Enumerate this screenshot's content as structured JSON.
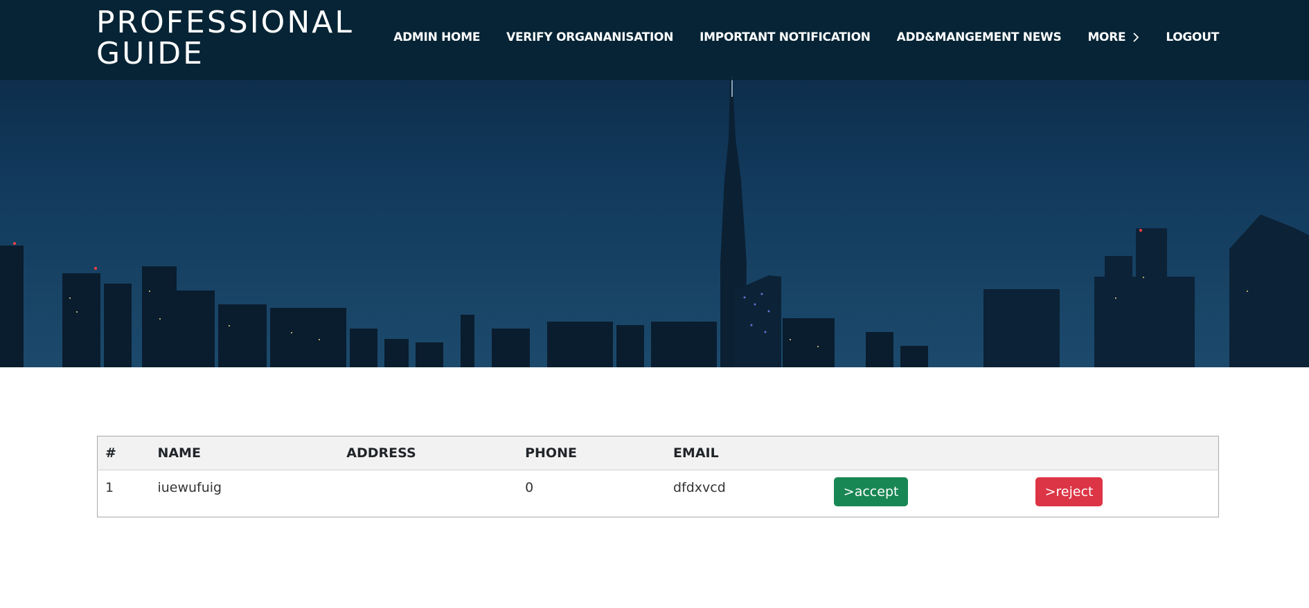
{
  "brand": {
    "line1": "PROFESSIONAL",
    "line2": "GUIDE"
  },
  "nav": {
    "items": [
      {
        "label": "ADMIN HOME"
      },
      {
        "label": "VERIFY ORGANANISATION"
      },
      {
        "label": "IMPORTANT NOTIFICATION"
      },
      {
        "label": "ADD&MANGEMENT NEWS"
      },
      {
        "label": "MORE",
        "icon": "chevron-right-icon"
      },
      {
        "label": "LOGOUT"
      }
    ]
  },
  "table": {
    "headers": [
      "#",
      "NAME",
      "ADDRESS",
      "PHONE",
      "EMAIL"
    ],
    "rows": [
      {
        "index": "1",
        "name": "iuewufuig",
        "address": "",
        "phone": "0",
        "email": "dfdxvcd",
        "accept_label": ">accept",
        "reject_label": ">reject"
      }
    ]
  },
  "colors": {
    "navbar": "#062434",
    "accept": "#198754",
    "reject": "#dc3545",
    "table_header_bg": "#f2f2f2"
  }
}
